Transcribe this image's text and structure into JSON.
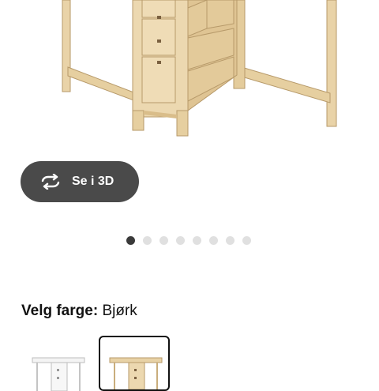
{
  "view3d": {
    "label": "Se i 3D",
    "icon": "rotate-3d-icon"
  },
  "carousel": {
    "total": 8,
    "active_index": 0
  },
  "color_picker": {
    "heading_label": "Velg farge:",
    "selected_value": "Bjørk",
    "options": [
      {
        "name": "white",
        "selected": false,
        "color": "#f2f2f2"
      },
      {
        "name": "birch",
        "selected": true,
        "color": "#e6cfa2"
      }
    ]
  },
  "colors": {
    "button_bg": "#4a4a4a",
    "dot_active": "#3a3a3a",
    "dot_inactive": "#e0e0e0",
    "wood": "#e8d2a6"
  }
}
